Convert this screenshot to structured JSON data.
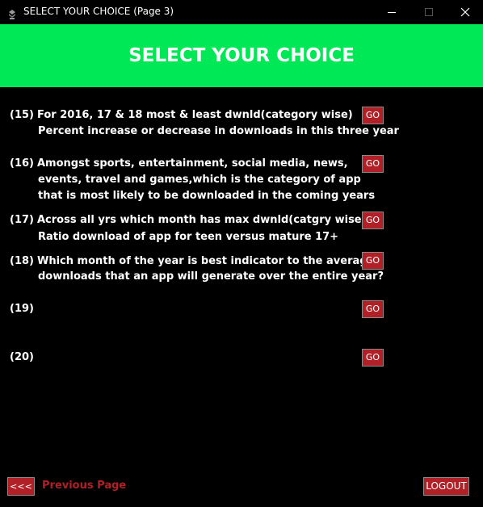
{
  "window": {
    "title": "SELECT YOUR CHOICE (Page 3)",
    "icon": "app-icon",
    "controls": [
      "minimize-icon",
      "maximize-icon",
      "close-icon"
    ]
  },
  "banner": {
    "title": "SELECT YOUR CHOICE"
  },
  "questions": [
    {
      "number": "(15)",
      "lines": [
        "For 2016, 17 & 18 most & least dwnld(category wise)",
        "Percent increase or decrease in downloads in this three year"
      ],
      "button": "GO"
    },
    {
      "number": "(16)",
      "lines": [
        "Amongst sports, entertainment, social media, news,",
        "events, travel and games,which is the category of app",
        "that is most likely to be downloaded in the coming years"
      ],
      "button": "GO"
    },
    {
      "number": "(17)",
      "lines": [
        "Across all yrs which month has max dwnld(catgry wise)",
        "Ratio download of app for teen versus mature 17+"
      ],
      "button": "GO"
    },
    {
      "number": "(18)",
      "lines": [
        "Which month of the year  is best indicator to the average",
        "downloads that an app will generate over the entire year?"
      ],
      "button": "GO"
    },
    {
      "number": "(19)",
      "lines": [],
      "button": "GO"
    },
    {
      "number": "(20)",
      "lines": [],
      "button": "GO"
    }
  ],
  "footer": {
    "back_button": "<<<",
    "previous_page": "Previous Page",
    "logout_button": "LOGOUT"
  },
  "colors": {
    "background": "#000000",
    "banner": "#00e855",
    "button": "#b02026",
    "text": "#ffffff"
  }
}
